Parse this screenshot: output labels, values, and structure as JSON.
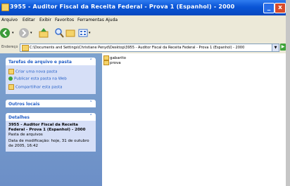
{
  "window": {
    "title": "3955 - Auditor Fiscal da Receita Federal - Prova 1 (Espanhol) - 2000",
    "minimize": "_",
    "close": "x"
  },
  "menu": [
    "Arquivo",
    "Editar",
    "Exibir",
    "Favoritos",
    "Ferramentas",
    "Ajuda"
  ],
  "address": {
    "label": "Endereço",
    "path": "C:\\Documents and Settings\\Christiane Penyd\\Desktop\\3955 - Auditor Fiscal da Receita Federal - Prova 1 (Espanhol) - 2000",
    "go": "▶"
  },
  "taskpane": {
    "file_tasks": {
      "title": "Tarefas de arquivo e pasta",
      "items": [
        "Criar uma nova pasta",
        "Publicar esta pasta na Web",
        "Compartilhar esta pasta"
      ]
    },
    "other_places": {
      "title": "Outros locais"
    },
    "details": {
      "title": "Detalhes",
      "name_lines": [
        "3955 - Auditor Fiscal da Receita",
        "Federal - Prova 1 (Espanhol) - 2000"
      ],
      "type": "Pasta de arquivos",
      "modified_lines": [
        "Data de modificação: hoje, 31 de outubro",
        "de 2005, 16:42"
      ]
    }
  },
  "files": [
    "gabarito",
    "prova"
  ],
  "colors": {
    "titlebar": "#0a55d6",
    "taskpane": "#7da2ce",
    "link": "#215dc6"
  }
}
